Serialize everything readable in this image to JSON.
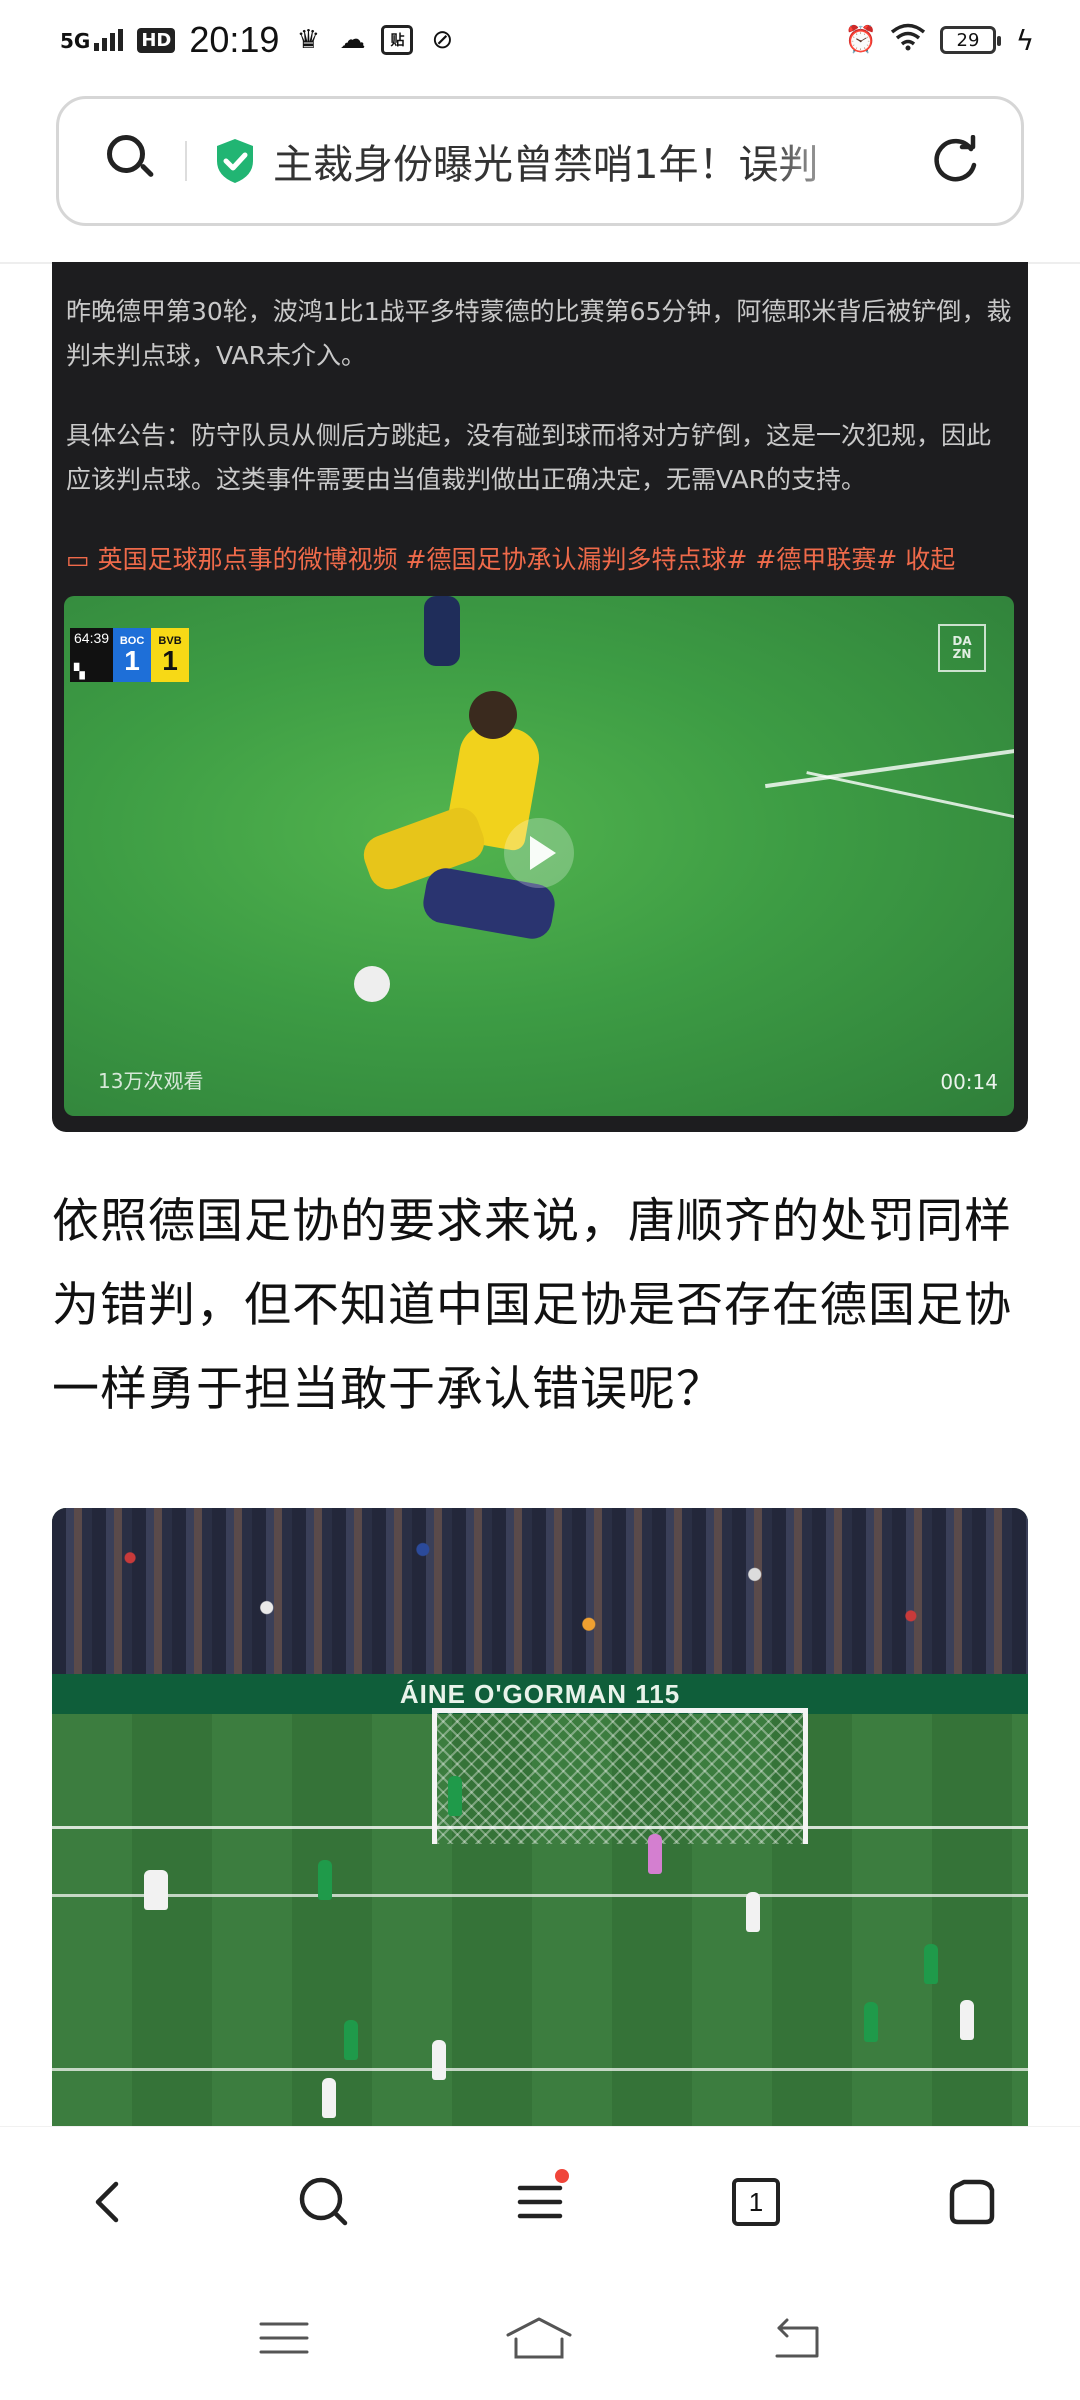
{
  "status_bar": {
    "network": "5G",
    "hd": "HD",
    "time": "20:19",
    "app_icon_label": "贴",
    "battery": "29"
  },
  "search_bar": {
    "headline": "主裁身份曝光曾禁哨1年！误判"
  },
  "post_card": {
    "paragraph1": "昨晚德甲第30轮，波鸿1比1战平多特蒙德的比赛第65分钟，阿德耶米背后被铲倒，裁判未判点球，VAR未介入。",
    "paragraph2": "具体公告：防守队员从侧后方跳起，没有碰到球而将对方铲倒，这是一次犯规，因此应该判点球。这类事件需要由当值裁判做出正确决定，无需VAR的支持。",
    "tags": "英国足球那点事的微博视频 #德国足协承认漏判多特点球# #德甲联赛# 收起",
    "video": {
      "match_time": "64:39",
      "home_code": "BOC",
      "home_score": "1",
      "away_code": "BVB",
      "away_score": "1",
      "broadcaster": "DAZN",
      "views": "13万次观看",
      "duration": "00:14"
    }
  },
  "article_text": "依照德国足协的要求来说，唐顺齐的处罚同样为错判，但不知道中国足协是否存在德国足协一样勇于担当敢于承认错误呢？",
  "photo": {
    "adboard_text": "ÁINE O'GORMAN 115"
  },
  "bottom_nav": {
    "tab_count": "1",
    "menu_has_notification": true
  },
  "colors": {
    "accent_shield": "#21b573",
    "tag_color": "#ef6a4a",
    "notification_dot": "#f0453a"
  }
}
